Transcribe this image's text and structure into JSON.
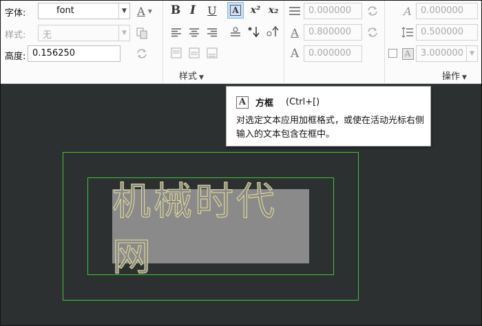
{
  "ribbon": {
    "font_label": "字体:",
    "font_value": "font",
    "style_label": "样式:",
    "style_value": "无",
    "height_label": "高度:",
    "height_value": "0.156250",
    "style_group_label": "样式",
    "ops_group_label": "操作",
    "text_color_icon": "A",
    "bold": "B",
    "italic": "I",
    "underline": "U",
    "boxed": "A",
    "superscript": "x²",
    "subscript": "x₂",
    "line_spacing_value": "0.000000",
    "width_factor_value": "0.800000",
    "oblique_value": "0.000000",
    "tracking_value": "0.000000",
    "line_space_value": "0.500000",
    "background_mask_value": "3.000000",
    "width_icon": "A",
    "oblique_icon": "A",
    "tracking_icon": "A",
    "mask_icon": "A"
  },
  "canvas": {
    "text": "机械时代网"
  },
  "tooltip": {
    "icon": "A",
    "name": "方框",
    "shortcut": "(Ctrl+[)",
    "description": "对选定文本应用加框格式，或使在活动光标右侧输入的文本包含在框中。"
  },
  "colors": {
    "canvas_bg": "#2c3030",
    "frame_green": "#45c33c",
    "text_yellow": "#e8e39a",
    "text_box_gray": "#8a8a8a"
  }
}
